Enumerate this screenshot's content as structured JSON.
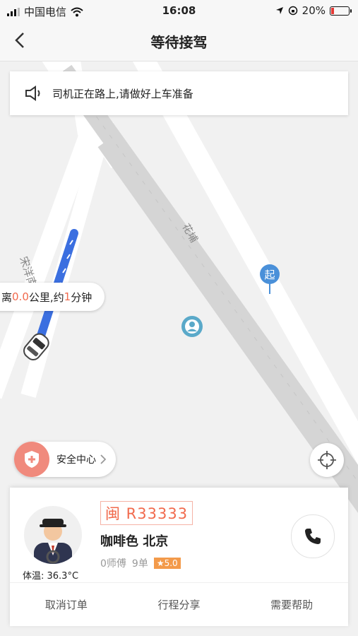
{
  "status": {
    "carrier": "中国电信",
    "time": "16:08",
    "battery": "20%",
    "battery_level": 0.2
  },
  "nav": {
    "title": "等待接驾",
    "back_icon": "chevron-left-icon"
  },
  "notice": {
    "icon": "speaker-icon",
    "text": "司机正在路上,请做好上车准备"
  },
  "map": {
    "road_labels": [
      "宋洋南",
      "花埔"
    ],
    "start_marker": "起",
    "eta": {
      "prefix": "离",
      "distance": "0.0",
      "mid": "公里,约",
      "minutes": "1",
      "suffix": "分钟"
    },
    "route_color": "#3b6fe0"
  },
  "safety": {
    "label": "安全中心",
    "icon": "shield-plus-icon"
  },
  "driver": {
    "plate": "闽 R33333",
    "car": "咖啡色 北京",
    "name": "0师傅",
    "orders": "9单",
    "rating": "5.0",
    "temperature": "体温:  36.3°C"
  },
  "actions": [
    "取消订单",
    "行程分享",
    "需要帮助"
  ],
  "colors": {
    "accent": "#f16a4d",
    "rating_bg": "#f39a4a"
  }
}
